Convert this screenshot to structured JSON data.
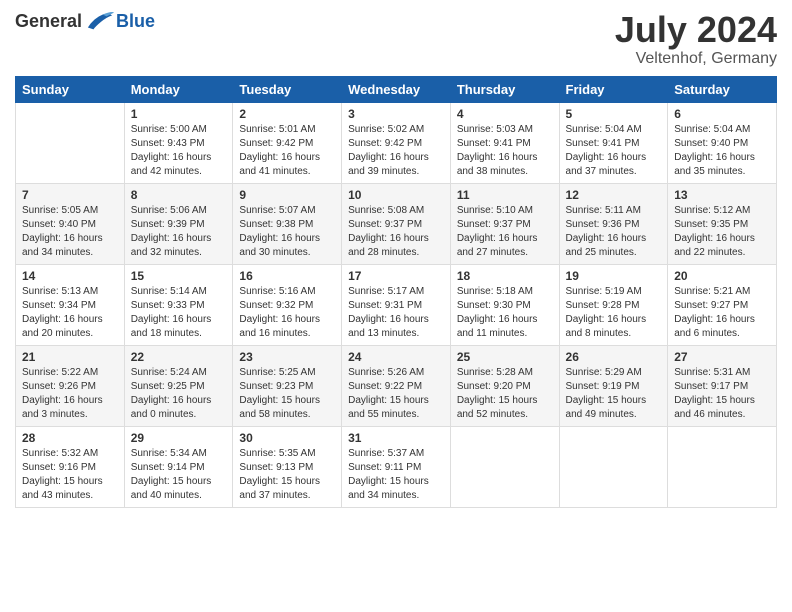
{
  "logo": {
    "general": "General",
    "blue": "Blue"
  },
  "title": "July 2024",
  "location": "Veltenhof, Germany",
  "weekdays": [
    "Sunday",
    "Monday",
    "Tuesday",
    "Wednesday",
    "Thursday",
    "Friday",
    "Saturday"
  ],
  "weeks": [
    [
      {
        "day": "",
        "info": ""
      },
      {
        "day": "1",
        "info": "Sunrise: 5:00 AM\nSunset: 9:43 PM\nDaylight: 16 hours\nand 42 minutes."
      },
      {
        "day": "2",
        "info": "Sunrise: 5:01 AM\nSunset: 9:42 PM\nDaylight: 16 hours\nand 41 minutes."
      },
      {
        "day": "3",
        "info": "Sunrise: 5:02 AM\nSunset: 9:42 PM\nDaylight: 16 hours\nand 39 minutes."
      },
      {
        "day": "4",
        "info": "Sunrise: 5:03 AM\nSunset: 9:41 PM\nDaylight: 16 hours\nand 38 minutes."
      },
      {
        "day": "5",
        "info": "Sunrise: 5:04 AM\nSunset: 9:41 PM\nDaylight: 16 hours\nand 37 minutes."
      },
      {
        "day": "6",
        "info": "Sunrise: 5:04 AM\nSunset: 9:40 PM\nDaylight: 16 hours\nand 35 minutes."
      }
    ],
    [
      {
        "day": "7",
        "info": "Sunrise: 5:05 AM\nSunset: 9:40 PM\nDaylight: 16 hours\nand 34 minutes."
      },
      {
        "day": "8",
        "info": "Sunrise: 5:06 AM\nSunset: 9:39 PM\nDaylight: 16 hours\nand 32 minutes."
      },
      {
        "day": "9",
        "info": "Sunrise: 5:07 AM\nSunset: 9:38 PM\nDaylight: 16 hours\nand 30 minutes."
      },
      {
        "day": "10",
        "info": "Sunrise: 5:08 AM\nSunset: 9:37 PM\nDaylight: 16 hours\nand 28 minutes."
      },
      {
        "day": "11",
        "info": "Sunrise: 5:10 AM\nSunset: 9:37 PM\nDaylight: 16 hours\nand 27 minutes."
      },
      {
        "day": "12",
        "info": "Sunrise: 5:11 AM\nSunset: 9:36 PM\nDaylight: 16 hours\nand 25 minutes."
      },
      {
        "day": "13",
        "info": "Sunrise: 5:12 AM\nSunset: 9:35 PM\nDaylight: 16 hours\nand 22 minutes."
      }
    ],
    [
      {
        "day": "14",
        "info": "Sunrise: 5:13 AM\nSunset: 9:34 PM\nDaylight: 16 hours\nand 20 minutes."
      },
      {
        "day": "15",
        "info": "Sunrise: 5:14 AM\nSunset: 9:33 PM\nDaylight: 16 hours\nand 18 minutes."
      },
      {
        "day": "16",
        "info": "Sunrise: 5:16 AM\nSunset: 9:32 PM\nDaylight: 16 hours\nand 16 minutes."
      },
      {
        "day": "17",
        "info": "Sunrise: 5:17 AM\nSunset: 9:31 PM\nDaylight: 16 hours\nand 13 minutes."
      },
      {
        "day": "18",
        "info": "Sunrise: 5:18 AM\nSunset: 9:30 PM\nDaylight: 16 hours\nand 11 minutes."
      },
      {
        "day": "19",
        "info": "Sunrise: 5:19 AM\nSunset: 9:28 PM\nDaylight: 16 hours\nand 8 minutes."
      },
      {
        "day": "20",
        "info": "Sunrise: 5:21 AM\nSunset: 9:27 PM\nDaylight: 16 hours\nand 6 minutes."
      }
    ],
    [
      {
        "day": "21",
        "info": "Sunrise: 5:22 AM\nSunset: 9:26 PM\nDaylight: 16 hours\nand 3 minutes."
      },
      {
        "day": "22",
        "info": "Sunrise: 5:24 AM\nSunset: 9:25 PM\nDaylight: 16 hours\nand 0 minutes."
      },
      {
        "day": "23",
        "info": "Sunrise: 5:25 AM\nSunset: 9:23 PM\nDaylight: 15 hours\nand 58 minutes."
      },
      {
        "day": "24",
        "info": "Sunrise: 5:26 AM\nSunset: 9:22 PM\nDaylight: 15 hours\nand 55 minutes."
      },
      {
        "day": "25",
        "info": "Sunrise: 5:28 AM\nSunset: 9:20 PM\nDaylight: 15 hours\nand 52 minutes."
      },
      {
        "day": "26",
        "info": "Sunrise: 5:29 AM\nSunset: 9:19 PM\nDaylight: 15 hours\nand 49 minutes."
      },
      {
        "day": "27",
        "info": "Sunrise: 5:31 AM\nSunset: 9:17 PM\nDaylight: 15 hours\nand 46 minutes."
      }
    ],
    [
      {
        "day": "28",
        "info": "Sunrise: 5:32 AM\nSunset: 9:16 PM\nDaylight: 15 hours\nand 43 minutes."
      },
      {
        "day": "29",
        "info": "Sunrise: 5:34 AM\nSunset: 9:14 PM\nDaylight: 15 hours\nand 40 minutes."
      },
      {
        "day": "30",
        "info": "Sunrise: 5:35 AM\nSunset: 9:13 PM\nDaylight: 15 hours\nand 37 minutes."
      },
      {
        "day": "31",
        "info": "Sunrise: 5:37 AM\nSunset: 9:11 PM\nDaylight: 15 hours\nand 34 minutes."
      },
      {
        "day": "",
        "info": ""
      },
      {
        "day": "",
        "info": ""
      },
      {
        "day": "",
        "info": ""
      }
    ]
  ]
}
